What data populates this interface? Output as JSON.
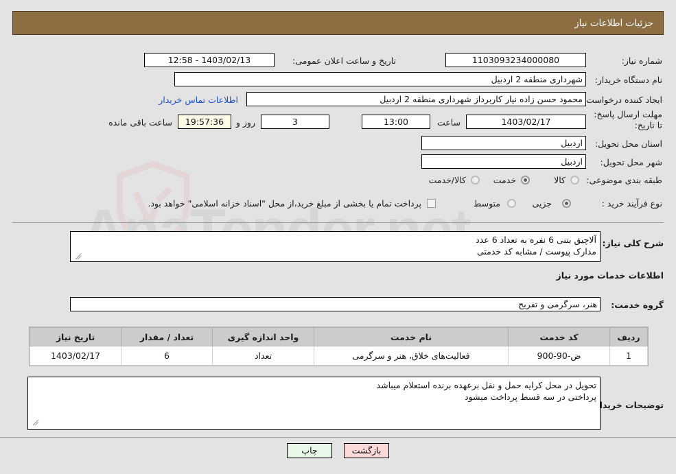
{
  "header": {
    "title": "جزئیات اطلاعات نیاز"
  },
  "form": {
    "need_number_label": "شماره نیاز:",
    "need_number_value": "1103093234000080",
    "announce_label": "تاریخ و ساعت اعلان عمومی:",
    "announce_value": "1403/02/13 - 12:58",
    "buyer_org_label": "نام دستگاه خریدار:",
    "buyer_org_value": "شهرداری منطقه 2 اردبیل",
    "creator_label": "ایجاد کننده درخواست:",
    "creator_value": "محمود حسن زاده نیار کاربرداز شهرداری منطقه 2 اردبیل",
    "contact_link": "اطلاعات تماس خریدار",
    "deadline_label": "مهلت ارسال پاسخ: تا تاریخ:",
    "deadline_date": "1403/02/17",
    "hour_label": "ساعت",
    "deadline_time": "13:00",
    "days_value": "3",
    "days_label": "روز و",
    "remaining_time": "19:57:36",
    "remaining_label": "ساعت باقی مانده",
    "province_label": "استان محل تحویل:",
    "province_value": "اردبیل",
    "city_label": "شهر محل تحویل:",
    "city_value": "اردبیل",
    "category_label": "طبقه بندی موضوعی:",
    "category_options": [
      {
        "label": "کالا",
        "selected": false
      },
      {
        "label": "خدمت",
        "selected": true
      },
      {
        "label": "کالا/خدمت",
        "selected": false
      }
    ],
    "process_label": "نوع فرآیند خرید :",
    "process_options": [
      {
        "label": "جزیی",
        "selected": true
      },
      {
        "label": "متوسط",
        "selected": false
      }
    ],
    "treasury_checkbox_label": "پرداخت تمام یا بخشی از مبلغ خرید،از محل \"اسناد خزانه اسلامی\" خواهد بود."
  },
  "details": {
    "need_desc_label": "شرح کلی نیاز:",
    "need_desc_value": "آلاچیق بتنی 6 نفره  به تعداد 6 عدد\nمدارک پیوست / مشابه کد خدمتی",
    "services_info_title": "اطلاعات خدمات مورد نیاز",
    "service_group_label": "گروه خدمت:",
    "service_group_value": "هنر، سرگرمی و تفریح"
  },
  "table": {
    "headers": [
      "ردیف",
      "کد خدمت",
      "نام خدمت",
      "واحد اندازه گیری",
      "تعداد / مقدار",
      "تاریخ نیاز"
    ],
    "rows": [
      {
        "row": "1",
        "service_code": "ض-90-900",
        "service_name": "فعالیت‌های خلاق، هنر و سرگرمی",
        "unit": "تعداد",
        "quantity": "6",
        "need_date": "1403/02/17"
      }
    ]
  },
  "notes": {
    "label": "توضیحات خریدار:",
    "value": "تحویل در محل کرایه حمل و نقل برعهده برنده استعلام میباشد\nپرداختی در  سه قسط پرداخت میشود"
  },
  "buttons": {
    "print": "چاپ",
    "back": "بازگشت"
  },
  "watermark": {
    "text": "AnaTender.net"
  },
  "colors": {
    "header_bar": "#8c6e42",
    "page_bg": "#e3e3e3",
    "link": "#1a4fd6",
    "table_header": "#cccccc",
    "print_button": "#e8f8e8",
    "back_button": "#fbd9d9",
    "countdown_bg": "#fbfbe8"
  }
}
